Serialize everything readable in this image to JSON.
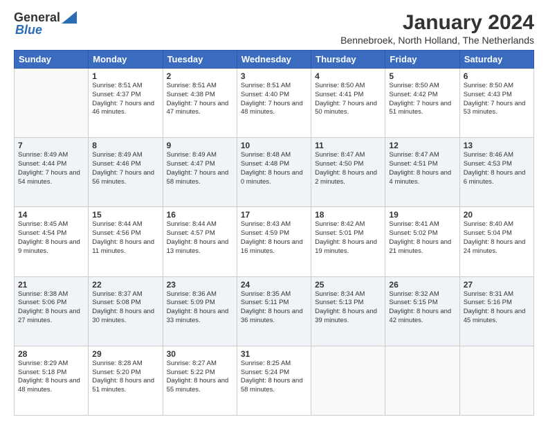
{
  "header": {
    "logo_line1": "General",
    "logo_line2": "Blue",
    "month_title": "January 2024",
    "subtitle": "Bennebroek, North Holland, The Netherlands"
  },
  "weekdays": [
    "Sunday",
    "Monday",
    "Tuesday",
    "Wednesday",
    "Thursday",
    "Friday",
    "Saturday"
  ],
  "weeks": [
    [
      {
        "day": "",
        "sunrise": "",
        "sunset": "",
        "daylight": ""
      },
      {
        "day": "1",
        "sunrise": "Sunrise: 8:51 AM",
        "sunset": "Sunset: 4:37 PM",
        "daylight": "Daylight: 7 hours and 46 minutes."
      },
      {
        "day": "2",
        "sunrise": "Sunrise: 8:51 AM",
        "sunset": "Sunset: 4:38 PM",
        "daylight": "Daylight: 7 hours and 47 minutes."
      },
      {
        "day": "3",
        "sunrise": "Sunrise: 8:51 AM",
        "sunset": "Sunset: 4:40 PM",
        "daylight": "Daylight: 7 hours and 48 minutes."
      },
      {
        "day": "4",
        "sunrise": "Sunrise: 8:50 AM",
        "sunset": "Sunset: 4:41 PM",
        "daylight": "Daylight: 7 hours and 50 minutes."
      },
      {
        "day": "5",
        "sunrise": "Sunrise: 8:50 AM",
        "sunset": "Sunset: 4:42 PM",
        "daylight": "Daylight: 7 hours and 51 minutes."
      },
      {
        "day": "6",
        "sunrise": "Sunrise: 8:50 AM",
        "sunset": "Sunset: 4:43 PM",
        "daylight": "Daylight: 7 hours and 53 minutes."
      }
    ],
    [
      {
        "day": "7",
        "sunrise": "Sunrise: 8:49 AM",
        "sunset": "Sunset: 4:44 PM",
        "daylight": "Daylight: 7 hours and 54 minutes."
      },
      {
        "day": "8",
        "sunrise": "Sunrise: 8:49 AM",
        "sunset": "Sunset: 4:46 PM",
        "daylight": "Daylight: 7 hours and 56 minutes."
      },
      {
        "day": "9",
        "sunrise": "Sunrise: 8:49 AM",
        "sunset": "Sunset: 4:47 PM",
        "daylight": "Daylight: 7 hours and 58 minutes."
      },
      {
        "day": "10",
        "sunrise": "Sunrise: 8:48 AM",
        "sunset": "Sunset: 4:48 PM",
        "daylight": "Daylight: 8 hours and 0 minutes."
      },
      {
        "day": "11",
        "sunrise": "Sunrise: 8:47 AM",
        "sunset": "Sunset: 4:50 PM",
        "daylight": "Daylight: 8 hours and 2 minutes."
      },
      {
        "day": "12",
        "sunrise": "Sunrise: 8:47 AM",
        "sunset": "Sunset: 4:51 PM",
        "daylight": "Daylight: 8 hours and 4 minutes."
      },
      {
        "day": "13",
        "sunrise": "Sunrise: 8:46 AM",
        "sunset": "Sunset: 4:53 PM",
        "daylight": "Daylight: 8 hours and 6 minutes."
      }
    ],
    [
      {
        "day": "14",
        "sunrise": "Sunrise: 8:45 AM",
        "sunset": "Sunset: 4:54 PM",
        "daylight": "Daylight: 8 hours and 9 minutes."
      },
      {
        "day": "15",
        "sunrise": "Sunrise: 8:44 AM",
        "sunset": "Sunset: 4:56 PM",
        "daylight": "Daylight: 8 hours and 11 minutes."
      },
      {
        "day": "16",
        "sunrise": "Sunrise: 8:44 AM",
        "sunset": "Sunset: 4:57 PM",
        "daylight": "Daylight: 8 hours and 13 minutes."
      },
      {
        "day": "17",
        "sunrise": "Sunrise: 8:43 AM",
        "sunset": "Sunset: 4:59 PM",
        "daylight": "Daylight: 8 hours and 16 minutes."
      },
      {
        "day": "18",
        "sunrise": "Sunrise: 8:42 AM",
        "sunset": "Sunset: 5:01 PM",
        "daylight": "Daylight: 8 hours and 19 minutes."
      },
      {
        "day": "19",
        "sunrise": "Sunrise: 8:41 AM",
        "sunset": "Sunset: 5:02 PM",
        "daylight": "Daylight: 8 hours and 21 minutes."
      },
      {
        "day": "20",
        "sunrise": "Sunrise: 8:40 AM",
        "sunset": "Sunset: 5:04 PM",
        "daylight": "Daylight: 8 hours and 24 minutes."
      }
    ],
    [
      {
        "day": "21",
        "sunrise": "Sunrise: 8:38 AM",
        "sunset": "Sunset: 5:06 PM",
        "daylight": "Daylight: 8 hours and 27 minutes."
      },
      {
        "day": "22",
        "sunrise": "Sunrise: 8:37 AM",
        "sunset": "Sunset: 5:08 PM",
        "daylight": "Daylight: 8 hours and 30 minutes."
      },
      {
        "day": "23",
        "sunrise": "Sunrise: 8:36 AM",
        "sunset": "Sunset: 5:09 PM",
        "daylight": "Daylight: 8 hours and 33 minutes."
      },
      {
        "day": "24",
        "sunrise": "Sunrise: 8:35 AM",
        "sunset": "Sunset: 5:11 PM",
        "daylight": "Daylight: 8 hours and 36 minutes."
      },
      {
        "day": "25",
        "sunrise": "Sunrise: 8:34 AM",
        "sunset": "Sunset: 5:13 PM",
        "daylight": "Daylight: 8 hours and 39 minutes."
      },
      {
        "day": "26",
        "sunrise": "Sunrise: 8:32 AM",
        "sunset": "Sunset: 5:15 PM",
        "daylight": "Daylight: 8 hours and 42 minutes."
      },
      {
        "day": "27",
        "sunrise": "Sunrise: 8:31 AM",
        "sunset": "Sunset: 5:16 PM",
        "daylight": "Daylight: 8 hours and 45 minutes."
      }
    ],
    [
      {
        "day": "28",
        "sunrise": "Sunrise: 8:29 AM",
        "sunset": "Sunset: 5:18 PM",
        "daylight": "Daylight: 8 hours and 48 minutes."
      },
      {
        "day": "29",
        "sunrise": "Sunrise: 8:28 AM",
        "sunset": "Sunset: 5:20 PM",
        "daylight": "Daylight: 8 hours and 51 minutes."
      },
      {
        "day": "30",
        "sunrise": "Sunrise: 8:27 AM",
        "sunset": "Sunset: 5:22 PM",
        "daylight": "Daylight: 8 hours and 55 minutes."
      },
      {
        "day": "31",
        "sunrise": "Sunrise: 8:25 AM",
        "sunset": "Sunset: 5:24 PM",
        "daylight": "Daylight: 8 hours and 58 minutes."
      },
      {
        "day": "",
        "sunrise": "",
        "sunset": "",
        "daylight": ""
      },
      {
        "day": "",
        "sunrise": "",
        "sunset": "",
        "daylight": ""
      },
      {
        "day": "",
        "sunrise": "",
        "sunset": "",
        "daylight": ""
      }
    ]
  ]
}
